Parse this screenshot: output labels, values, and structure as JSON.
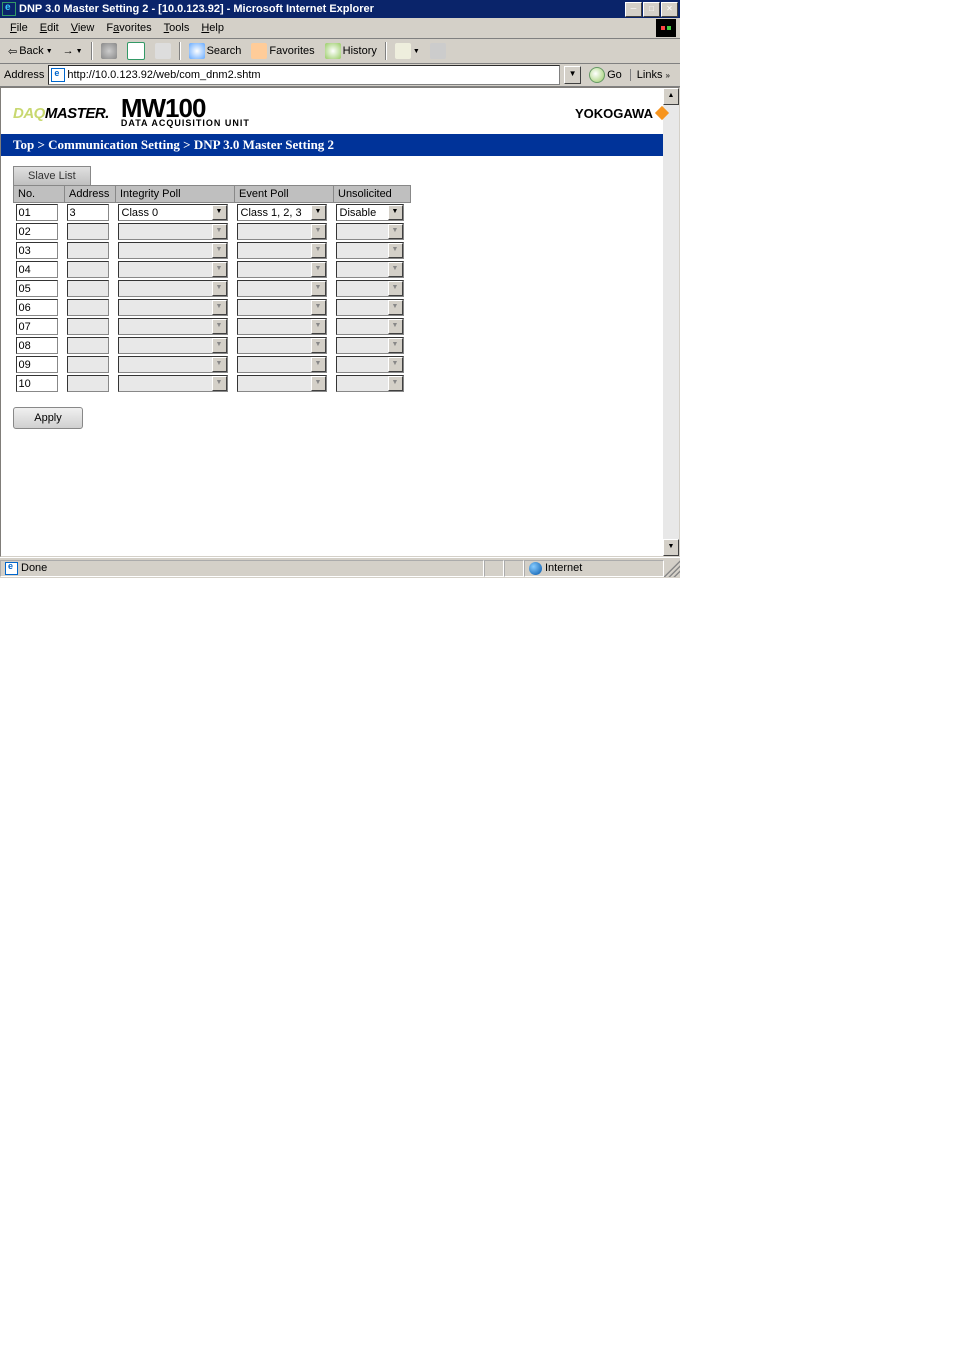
{
  "window": {
    "title": "DNP 3.0 Master Setting 2 - [10.0.123.92] - Microsoft Internet Explorer"
  },
  "menubar": {
    "file": "File",
    "edit": "Edit",
    "view": "View",
    "favorites": "Favorites",
    "tools": "Tools",
    "help": "Help"
  },
  "toolbar": {
    "back": "Back",
    "search": "Search",
    "favorites": "Favorites",
    "history": "History"
  },
  "addressbar": {
    "label": "Address",
    "url": "http://10.0.123.92/web/com_dnm2.shtm",
    "go": "Go",
    "links": "Links"
  },
  "logo": {
    "daqmaster_daq": "DAQ",
    "daqmaster_master": "MASTER",
    "mw100": "MW100",
    "mw100_sub": "DATA ACQUISITION UNIT",
    "yokogawa": "YOKOGAWA"
  },
  "breadcrumb": "Top > Communication Setting > DNP 3.0 Master Setting 2",
  "tab": "Slave List",
  "table": {
    "headers": {
      "no": "No.",
      "address": "Address",
      "integrity": "Integrity Poll",
      "event": "Event Poll",
      "unsolicited": "Unsolicited"
    },
    "rows": [
      {
        "no": "01",
        "address": "3",
        "integrity": "Class 0",
        "event": "Class 1, 2, 3",
        "unsolicited": "Disable",
        "enabled": true
      },
      {
        "no": "02",
        "address": "",
        "integrity": "",
        "event": "",
        "unsolicited": "",
        "enabled": false
      },
      {
        "no": "03",
        "address": "",
        "integrity": "",
        "event": "",
        "unsolicited": "",
        "enabled": false
      },
      {
        "no": "04",
        "address": "",
        "integrity": "",
        "event": "",
        "unsolicited": "",
        "enabled": false
      },
      {
        "no": "05",
        "address": "",
        "integrity": "",
        "event": "",
        "unsolicited": "",
        "enabled": false
      },
      {
        "no": "06",
        "address": "",
        "integrity": "",
        "event": "",
        "unsolicited": "",
        "enabled": false
      },
      {
        "no": "07",
        "address": "",
        "integrity": "",
        "event": "",
        "unsolicited": "",
        "enabled": false
      },
      {
        "no": "08",
        "address": "",
        "integrity": "",
        "event": "",
        "unsolicited": "",
        "enabled": false
      },
      {
        "no": "09",
        "address": "",
        "integrity": "",
        "event": "",
        "unsolicited": "",
        "enabled": false
      },
      {
        "no": "10",
        "address": "",
        "integrity": "",
        "event": "",
        "unsolicited": "",
        "enabled": false
      }
    ]
  },
  "buttons": {
    "apply": "Apply"
  },
  "statusbar": {
    "done": "Done",
    "zone": "Internet"
  }
}
